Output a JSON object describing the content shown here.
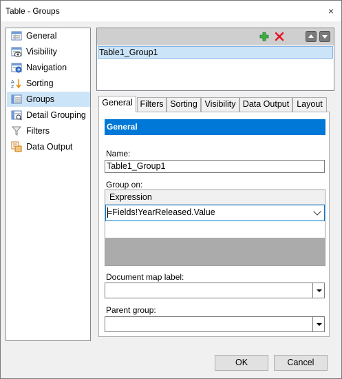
{
  "window": {
    "title": "Table - Groups",
    "close_glyph": "×"
  },
  "nav": {
    "items": [
      {
        "label": "General",
        "icon": "general-icon",
        "selected": false
      },
      {
        "label": "Visibility",
        "icon": "visibility-icon",
        "selected": false
      },
      {
        "label": "Navigation",
        "icon": "navigation-icon",
        "selected": false
      },
      {
        "label": "Sorting",
        "icon": "sorting-icon",
        "selected": false
      },
      {
        "label": "Groups",
        "icon": "groups-icon",
        "selected": true
      },
      {
        "label": "Detail Grouping",
        "icon": "detail-grouping-icon",
        "selected": false
      },
      {
        "label": "Filters",
        "icon": "filters-icon",
        "selected": false
      },
      {
        "label": "Data Output",
        "icon": "data-output-icon",
        "selected": false
      }
    ]
  },
  "groups": {
    "toolbar": [
      "add-icon",
      "delete-icon",
      "move-up-icon",
      "move-down-icon"
    ],
    "items": [
      "Table1_Group1"
    ]
  },
  "tabs": [
    {
      "label": "General",
      "active": true
    },
    {
      "label": "Filters",
      "active": false
    },
    {
      "label": "Sorting",
      "active": false
    },
    {
      "label": "Visibility",
      "active": false
    },
    {
      "label": "Data Output",
      "active": false
    },
    {
      "label": "Layout",
      "active": false
    }
  ],
  "panel": {
    "header": "General",
    "name_label": "Name:",
    "name_value": "Table1_Group1",
    "group_on_label": "Group on:",
    "expression_header": "Expression",
    "expression_value": "=Fields!YearReleased.Value",
    "document_map_label": "Document map label:",
    "document_map_value": "",
    "parent_group_label": "Parent group:",
    "parent_group_value": ""
  },
  "buttons": {
    "ok": "OK",
    "cancel": "Cancel"
  },
  "colors": {
    "accent": "#0078d7",
    "selection": "#cce4f7",
    "add": "#3cb043",
    "delete": "#e81123"
  }
}
